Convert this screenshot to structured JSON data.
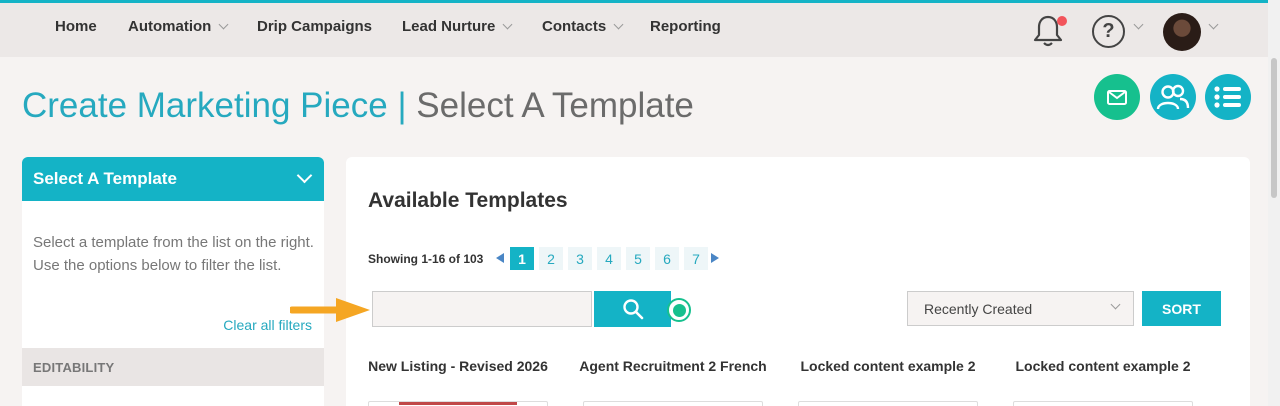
{
  "nav": {
    "items": [
      {
        "label": "Home",
        "dropdown": false
      },
      {
        "label": "Automation",
        "dropdown": true
      },
      {
        "label": "Drip Campaigns",
        "dropdown": false
      },
      {
        "label": "Lead Nurture",
        "dropdown": true
      },
      {
        "label": "Contacts",
        "dropdown": true
      },
      {
        "label": "Reporting",
        "dropdown": false
      }
    ],
    "help_symbol": "?",
    "icons": {
      "notifications": "bell-icon",
      "help": "question-circle-icon",
      "avatar": "user-avatar"
    }
  },
  "page_title": {
    "main": "Create Marketing Piece",
    "separator": "|",
    "sub": "Select A Template"
  },
  "action_buttons": [
    "mail-icon",
    "users-icon",
    "list-icon"
  ],
  "sidebar": {
    "header": "Select A Template",
    "description": "Select a template from the list on the right. Use the options below to filter the list.",
    "clear_filters": "Clear all filters",
    "section_editability": "EDITABILITY"
  },
  "main": {
    "title": "Available Templates",
    "showing": "Showing 1-16 of 103",
    "pages": [
      "1",
      "2",
      "3",
      "4",
      "5",
      "6",
      "7"
    ],
    "active_page": "1",
    "search": {
      "value": "",
      "placeholder": ""
    },
    "sort": {
      "selected": "Recently Created",
      "button": "SORT"
    },
    "templates": [
      {
        "name": "New Listing - Revised 2026"
      },
      {
        "name": "Agent Recruitment 2 French"
      },
      {
        "name": "Locked content example 2"
      },
      {
        "name": "Locked content example 2"
      }
    ]
  },
  "colors": {
    "accent": "#14b3c6",
    "green": "#16c08e",
    "notification_dot": "#f2545b",
    "annotation_arrow": "#f5a623"
  }
}
